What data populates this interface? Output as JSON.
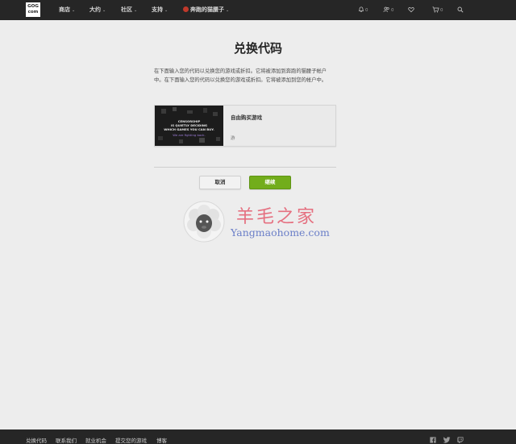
{
  "nav": {
    "logo_line1": "GOG",
    "logo_line2": "com",
    "store": "商店",
    "about": "大约",
    "community": "社区",
    "support": "支持",
    "username": "奔跑的猫腰子",
    "notifications_count": "0",
    "friends_count": "0",
    "cart_count": "0"
  },
  "main": {
    "title": "兑换代码",
    "description": "在下面输入您的代码以兑换您的游戏或折扣。它将被添加到奔跑的猫腰子帐户中。在下面输入您的代码以兑换您的游戏或折扣。它将被添加到您的帐户中。",
    "product": {
      "image_line1": "CENSORSHIP",
      "image_line2": "IS QUIETLY DECIDING",
      "image_line3": "WHICH GAMES YOU CAN BUY.",
      "image_line4": "We are fighting back.",
      "name": "自由购买游戏",
      "platform": "游"
    },
    "cancel_label": "取消",
    "continue_label": "继续"
  },
  "watermark": {
    "cn": "羊毛之家",
    "en": "Yangmaohome.com"
  },
  "footer": {
    "links": [
      "兑换代码",
      "联系我们",
      "就业机会",
      "提交您的游戏",
      "博客"
    ]
  }
}
